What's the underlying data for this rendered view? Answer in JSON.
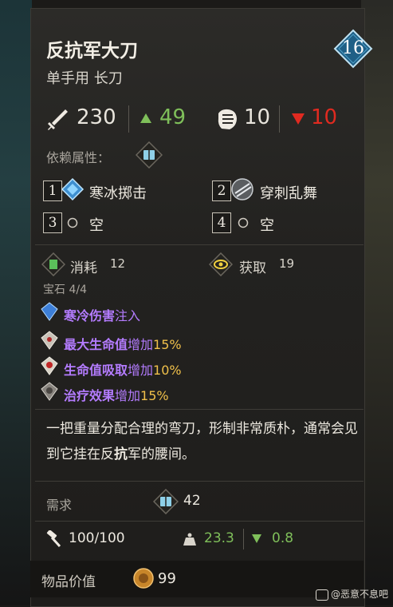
{
  "item": {
    "name": "反抗军大刀",
    "type": "单手用 长刀",
    "level": "16"
  },
  "stats": {
    "attack": "230",
    "attack_gain": "49",
    "weight": "10",
    "weight_loss": "10"
  },
  "dependency": {
    "label": "依赖属性："
  },
  "skills": [
    {
      "slot": "1",
      "name": "寒冰掷击"
    },
    {
      "slot": "2",
      "name": "穿刺乱舞"
    },
    {
      "slot": "3",
      "name": "空"
    },
    {
      "slot": "4",
      "name": "空"
    }
  ],
  "consume": {
    "label": "消耗",
    "value": "12"
  },
  "obtain": {
    "label": "获取",
    "value": "19"
  },
  "gems": {
    "label": "宝石 4/4",
    "items": [
      {
        "name": "寒冷伤害",
        "suffix": "注入",
        "bonus": ""
      },
      {
        "name": "最大生命值",
        "suffix": "增加",
        "bonus": "15%"
      },
      {
        "name": "生命值吸取",
        "suffix": "增加",
        "bonus": "10%"
      },
      {
        "name": "治疗效果",
        "suffix": "增加",
        "bonus": "15%"
      }
    ]
  },
  "description": {
    "pre": "一把重量分配合理的弯刀，形制非常质朴，通常会见到它挂在反",
    "keyword": "抗",
    "post": "军的腰间。"
  },
  "requirement": {
    "label": "需求",
    "value": "42"
  },
  "durability": {
    "value": "100/100",
    "weight_up": "23.3",
    "weight_down": "0.8"
  },
  "value": {
    "label": "物品价值",
    "amount": "99"
  },
  "watermark": "@恶意不息吧",
  "colors": {
    "accent_green": "#7fbf5a",
    "accent_red": "#e02a20",
    "gem_purple": "#b47cff",
    "bonus_gold": "#f0c04a"
  },
  "icons": [
    "sword-icon",
    "gauntlet-icon",
    "book-icon",
    "frost-gem-icon",
    "pierce-icon",
    "consume-icon",
    "eye-icon",
    "gem-icon",
    "hammer-icon",
    "weight-icon",
    "coin-icon"
  ]
}
